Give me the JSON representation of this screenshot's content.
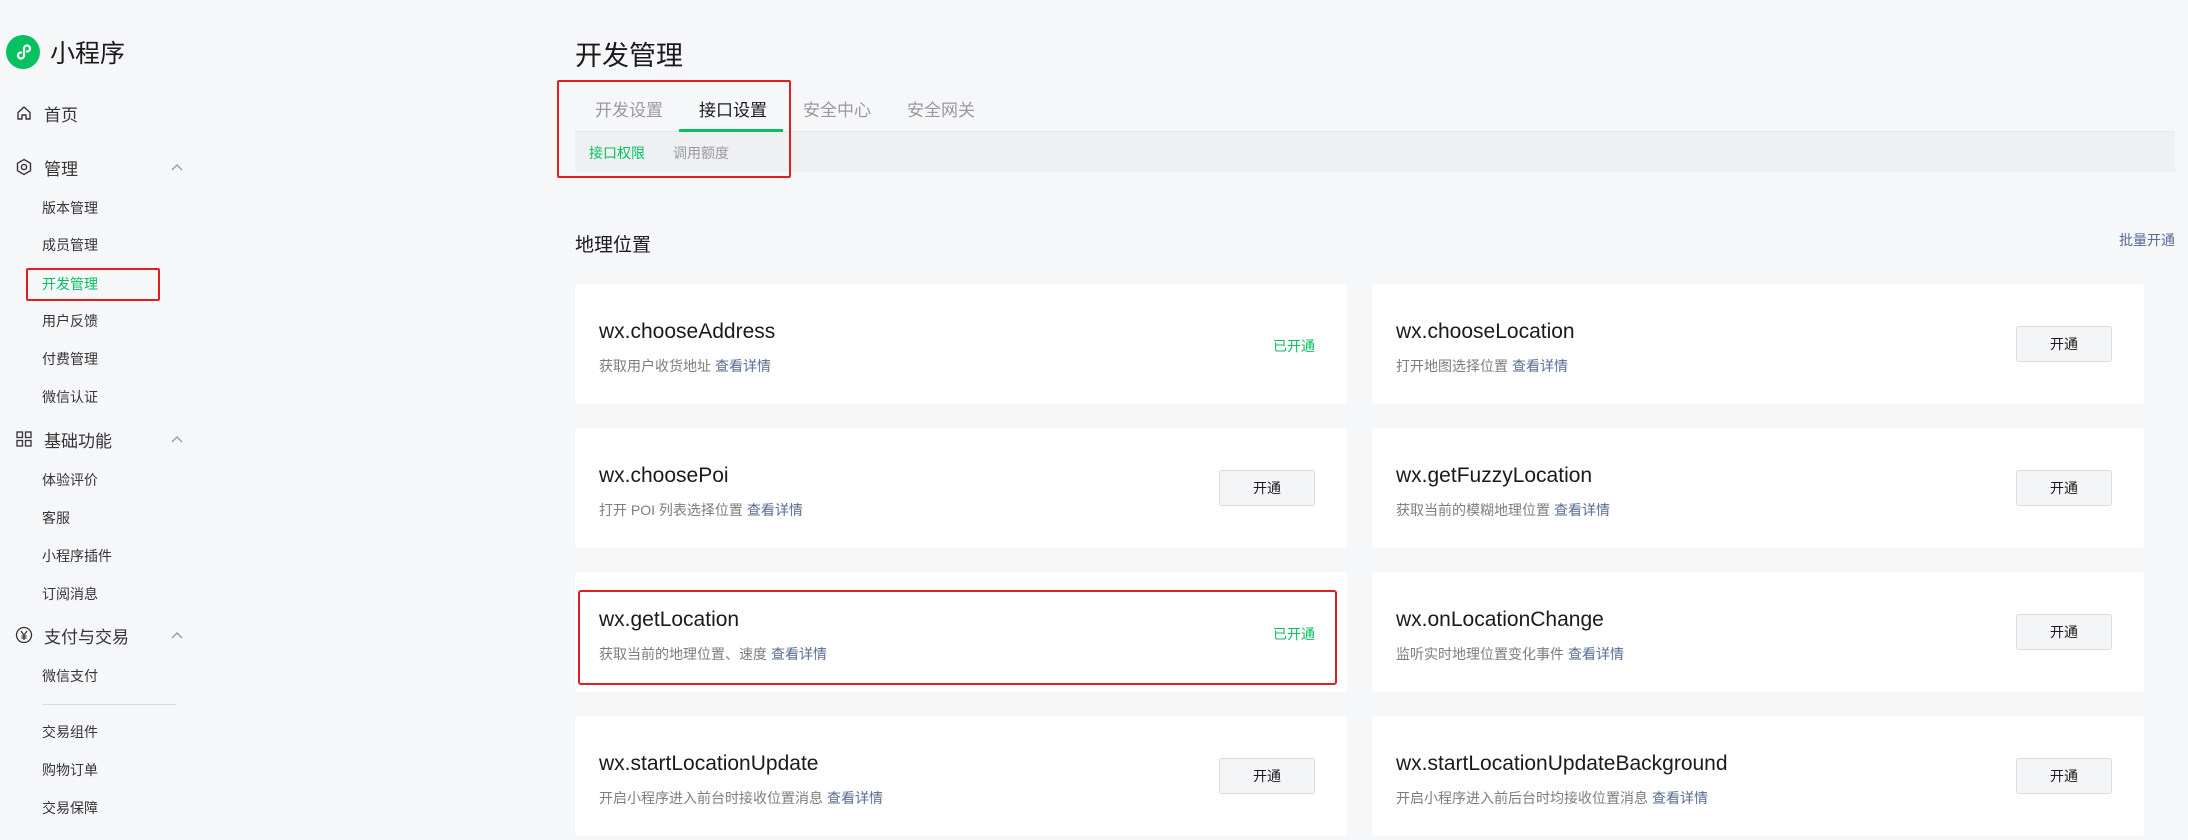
{
  "app": {
    "logo_text": "小程序",
    "logo_icon": "miniprogram-icon",
    "brand_color": "#07c160",
    "highlight_color": "#e02020"
  },
  "sidebar": {
    "home": {
      "label": "首页",
      "icon": "home-icon"
    },
    "groups": [
      {
        "label": "管理",
        "icon": "gear-icon",
        "items": [
          "版本管理",
          "成员管理",
          "开发管理",
          "用户反馈",
          "付费管理",
          "微信认证"
        ]
      },
      {
        "label": "基础功能",
        "icon": "grid-icon",
        "items": [
          "体验评价",
          "客服",
          "小程序插件",
          "订阅消息"
        ]
      },
      {
        "label": "支付与交易",
        "icon": "yuan-icon",
        "items": [
          "微信支付",
          "交易组件",
          "购物订单",
          "交易保障"
        ]
      }
    ],
    "active_item": "开发管理"
  },
  "main": {
    "title": "开发管理",
    "tabs": [
      "开发设置",
      "接口设置",
      "安全中心",
      "安全网关"
    ],
    "active_tab": "接口设置",
    "subtabs": [
      "接口权限",
      "调用额度"
    ],
    "active_subtab": "接口权限",
    "section_title": "地理位置",
    "batch_link": "批量开通",
    "detail_link": "查看详情",
    "enabled_text": "已开通",
    "enable_button": "开通",
    "apis": [
      {
        "name": "wx.chooseAddress",
        "desc": "获取用户收货地址",
        "enabled": true
      },
      {
        "name": "wx.chooseLocation",
        "desc": "打开地图选择位置",
        "enabled": false
      },
      {
        "name": "wx.choosePoi",
        "desc": "打开 POI 列表选择位置",
        "enabled": false
      },
      {
        "name": "wx.getFuzzyLocation",
        "desc": "获取当前的模糊地理位置",
        "enabled": false
      },
      {
        "name": "wx.getLocation",
        "desc": "获取当前的地理位置、速度",
        "enabled": true
      },
      {
        "name": "wx.onLocationChange",
        "desc": "监听实时地理位置变化事件",
        "enabled": false
      },
      {
        "name": "wx.startLocationUpdate",
        "desc": "开启小程序进入前台时接收位置消息",
        "enabled": false
      },
      {
        "name": "wx.startLocationUpdateBackground",
        "desc": "开启小程序进入前后台时均接收位置消息",
        "enabled": false
      }
    ]
  }
}
